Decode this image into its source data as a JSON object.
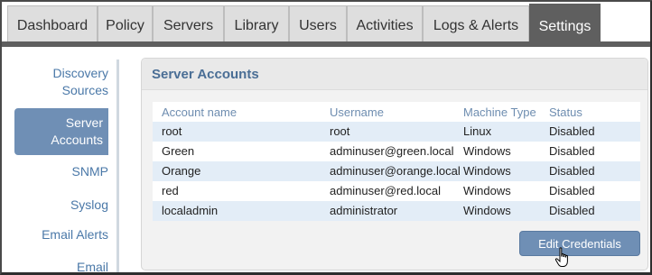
{
  "tabs": [
    {
      "label": "Dashboard"
    },
    {
      "label": "Policy"
    },
    {
      "label": "Servers"
    },
    {
      "label": "Library"
    },
    {
      "label": "Users"
    },
    {
      "label": "Activities"
    },
    {
      "label": "Logs & Alerts"
    },
    {
      "label": "Settings",
      "active": true
    }
  ],
  "sidebar": {
    "items": [
      {
        "label": "Discovery Sources"
      },
      {
        "label": "Server Accounts",
        "active": true
      },
      {
        "label": "SNMP"
      },
      {
        "label": "Syslog"
      },
      {
        "label": "Email Alerts"
      },
      {
        "label": "Email"
      }
    ]
  },
  "panel": {
    "title": "Server Accounts",
    "columns": [
      "Account name",
      "Username",
      "Machine Type",
      "Status"
    ],
    "rows": [
      [
        "root",
        "root",
        "Linux",
        "Disabled"
      ],
      [
        "Green",
        "adminuser@green.local",
        "Windows",
        "Disabled"
      ],
      [
        "Orange",
        "adminuser@orange.local",
        "Windows",
        "Disabled"
      ],
      [
        "red",
        "adminuser@red.local",
        "Windows",
        "Disabled"
      ],
      [
        "localadmin",
        "administrator",
        "Windows",
        "Disabled"
      ]
    ],
    "edit_button": "Edit Credentials"
  },
  "colors": {
    "active_tab": "#5f5f5f",
    "accent": "#6f8fb5",
    "link": "#4a78a8",
    "row_alt": "#e3edf7"
  }
}
